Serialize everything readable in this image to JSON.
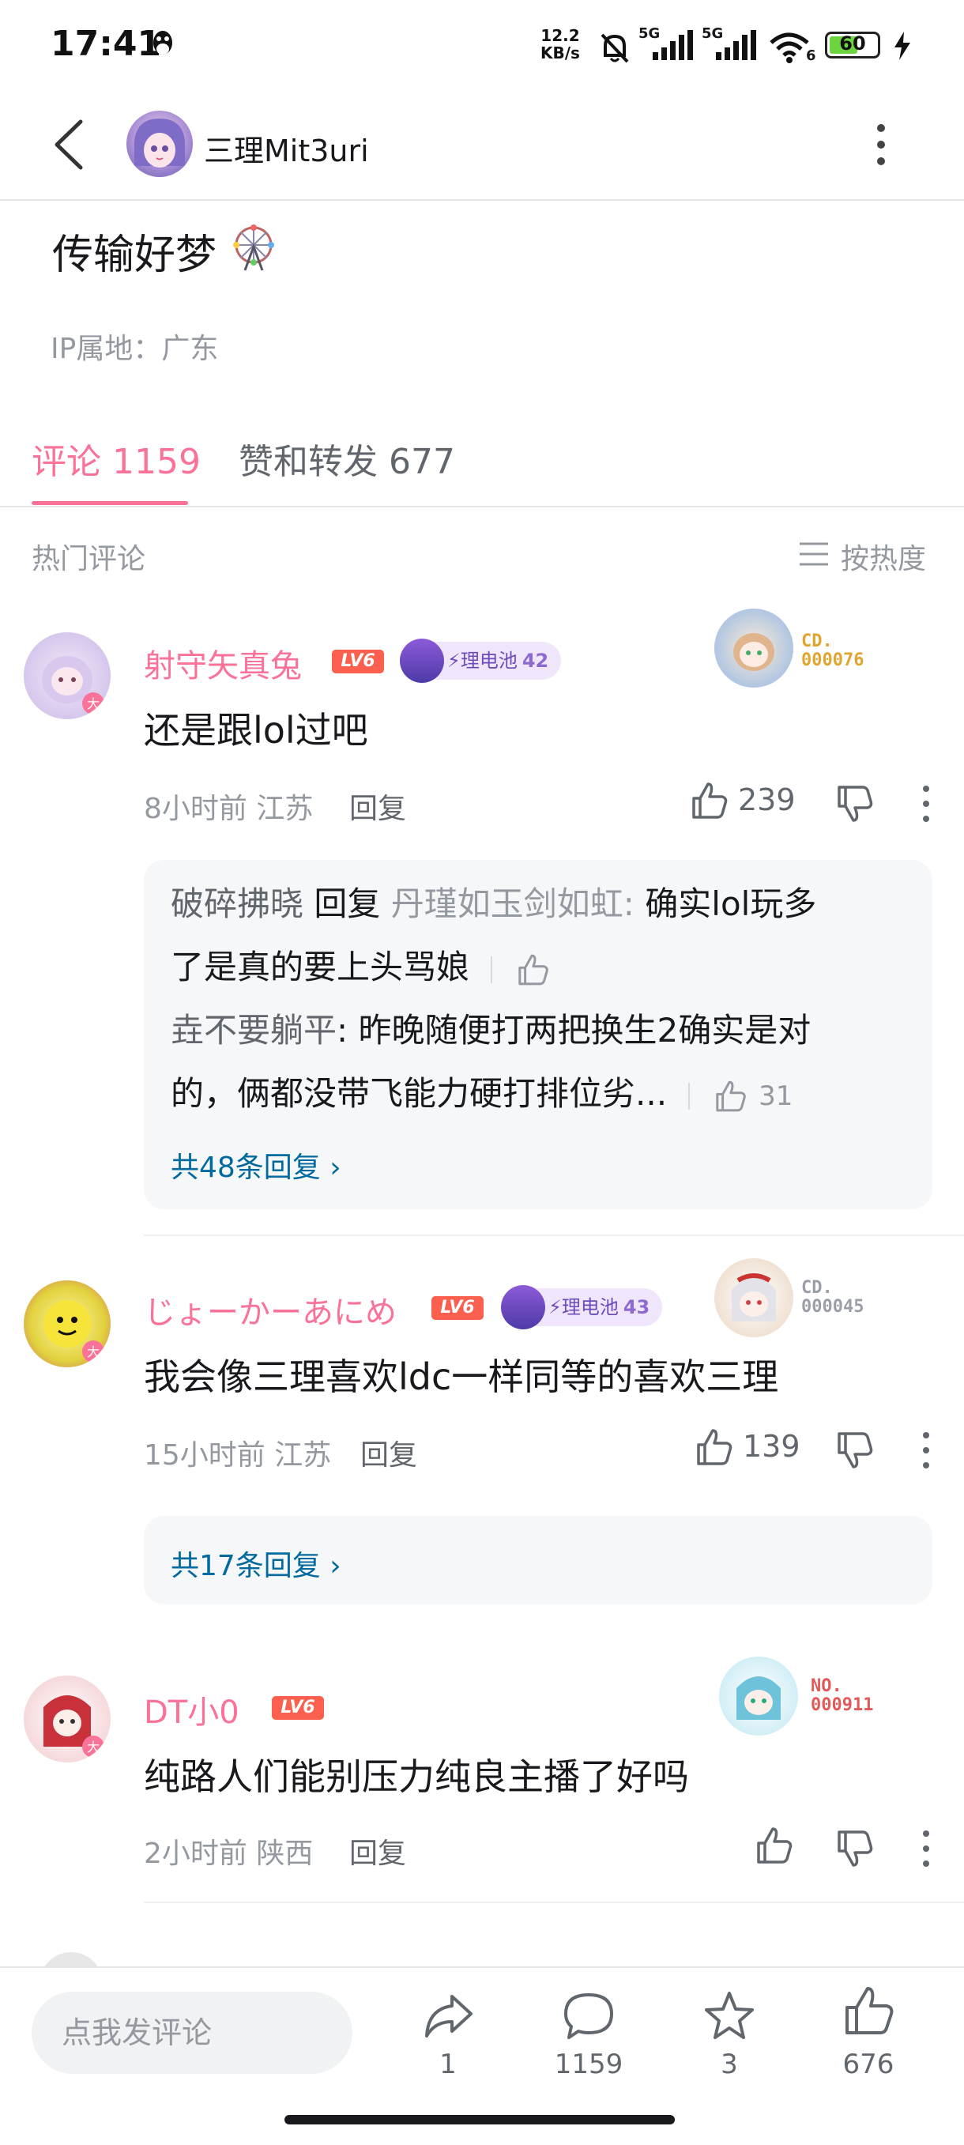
{
  "status_bar": {
    "time": "17:41",
    "net_speed_value": "12.2",
    "net_speed_unit": "KB/s",
    "net1": "5G",
    "net2": "5G",
    "wifi_badge": "6",
    "battery": "60",
    "battery_level": 0.6
  },
  "header": {
    "name": "三理Mit3uri"
  },
  "post": {
    "text": "传输好梦",
    "ip": "IP属地：广东"
  },
  "tabs": [
    {
      "label": "评论 1159"
    },
    {
      "label": "赞和转发 677"
    }
  ],
  "section": {
    "hot_label": "热门评论",
    "sort_label": "按热度"
  },
  "comments": [
    {
      "username": "射守矢真兔",
      "level": "LV6",
      "medal": {
        "name": "理电池",
        "level": "42"
      },
      "fan_badge_line1": "CD.",
      "fan_badge_line2": "000076",
      "text": "还是跟lol过吧",
      "time": "8小时前",
      "location": "江苏",
      "reply": "回复",
      "likes": "239",
      "replies": [
        {
          "user": "破碎拂晓",
          "reply_word": "回复",
          "target": "丹瑾如玉剑如虹",
          "text1": "确实lol玩多",
          "text2": "了是真的要上头骂娘",
          "likes": ""
        },
        {
          "user": "垚不要躺平",
          "text1": "昨晚随便打两把换生2确实是对",
          "text2": "的，俩都没带飞能力硬打排位劣...",
          "likes": "31"
        }
      ],
      "view_all": "共48条回复"
    },
    {
      "username": "じょーかーあにめ",
      "level": "LV6",
      "medal": {
        "name": "理电池",
        "level": "43"
      },
      "fan_badge_line1": "CD.",
      "fan_badge_line2": "000045",
      "text": "我会像三理喜欢ldc一样同等的喜欢三理",
      "time": "15小时前",
      "location": "江苏",
      "reply": "回复",
      "likes": "139",
      "view_all": "共17条回复"
    },
    {
      "username": "DT小0",
      "level": "LV6",
      "fan_badge_line1": "NO.",
      "fan_badge_line2": "000911",
      "text": "纯路人们能别压力纯良主播了好吗",
      "time": "2小时前",
      "location": "陕西",
      "reply": "回复",
      "likes": ""
    }
  ],
  "bottom_bar": {
    "input_placeholder": "点我发评论",
    "share_count": "1",
    "comment_count": "1159",
    "star_count": "3",
    "like_count": "676"
  },
  "colors": {
    "accent": "#fb7299",
    "link": "#00699d",
    "level_badge": "#fb5f4d",
    "medal_bg": "#efe6fb"
  }
}
